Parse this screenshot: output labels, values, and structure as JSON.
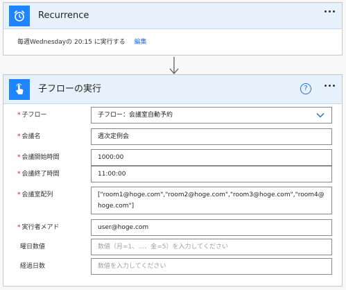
{
  "recurrence": {
    "title": "Recurrence",
    "summary_text": "毎週Wednesdayの 20:15 に実行する",
    "edit_label": "編集"
  },
  "child_flow": {
    "title": "子フローの実行",
    "fields": {
      "child_flow": {
        "label": "子フロー",
        "value": "子フロー：会議室自動予約"
      },
      "meeting_name": {
        "label": "会議名",
        "value": "週次定例会"
      },
      "start_time": {
        "label": "会議開始時間",
        "value": "1000:00"
      },
      "end_time": {
        "label": "会議終了時間",
        "value": "11:00:00"
      },
      "room_array": {
        "label": "会議室配列",
        "value": "[\"room1@hoge.com\",\"room2@hoge.com\",\"room3@hoge.com\",\"room4@hoge.com\"]"
      },
      "executor": {
        "label": "実行者メアド",
        "value": "user@hoge.com"
      },
      "weekday": {
        "label": "曜日数値",
        "placeholder": "数値（月=1、…、金=5）を入力してください"
      },
      "elapsed_days": {
        "label": "経過日数",
        "placeholder": "数値を入力してください"
      }
    }
  },
  "colors": {
    "header_bg": "#e6f1fb",
    "icon_bg": "#1f85ff",
    "link": "#1f6fd6",
    "required": "#e81123"
  },
  "icons": {
    "recurrence": "alarm-clock-icon",
    "child_flow": "touch-hand-icon",
    "more": "more-options-icon",
    "help": "help-icon",
    "dropdown": "chevron-down-icon",
    "connector": "arrow-down-icon"
  }
}
